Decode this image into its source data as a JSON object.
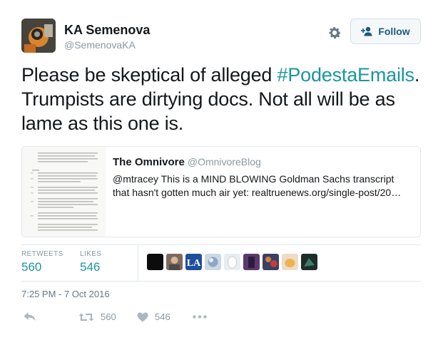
{
  "author": {
    "display_name": "KA Semenova",
    "handle": "@SemenovaKA",
    "avatar_icon": "avatar-photo-icon"
  },
  "header": {
    "follow_label": "Follow",
    "settings_icon": "gear-icon"
  },
  "tweet": {
    "text_before": "Please be skeptical of alleged ",
    "hashtag": "#PodestaEmails",
    "text_after": ". Trumpists are dirtying docs. Not all will be as lame as this one is."
  },
  "quote": {
    "name": "The Omnivore",
    "handle": "@OmnivoreBlog",
    "text": "@mtracey This is a MIND BLOWING Goldman Sachs transcript that hasn't gotten much air yet: realtruenews.org/single-post/20…"
  },
  "stats": {
    "retweets_label": "RETWEETS",
    "retweets_value": "560",
    "likes_label": "LIKES",
    "likes_value": "546"
  },
  "timestamp": "7:25 PM - 7 Oct 2016",
  "actions": {
    "reply_icon": "reply-icon",
    "retweet_icon": "retweet-icon",
    "retweet_count": "560",
    "like_icon": "heart-icon",
    "like_count": "546",
    "more_icon": "more-icon"
  },
  "colors": {
    "accent": "#1b95a0",
    "follow_text": "#1b5980",
    "muted": "#8899a6"
  }
}
